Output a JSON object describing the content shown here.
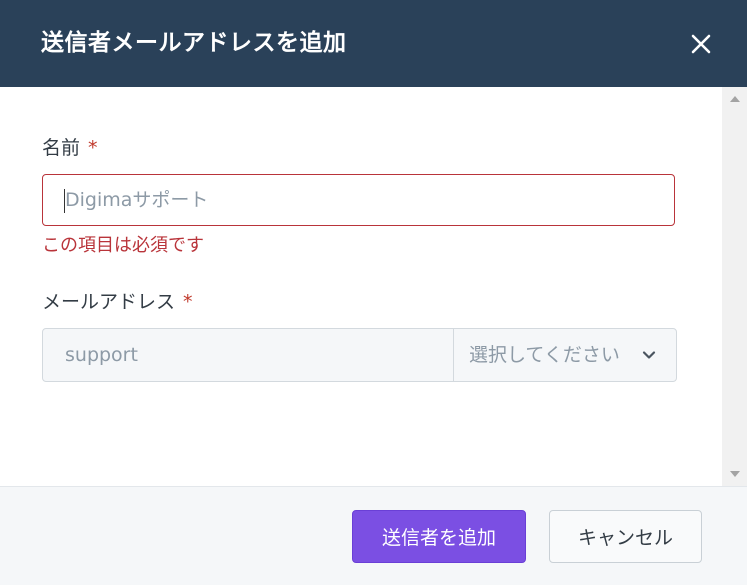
{
  "dialog": {
    "title": "送信者メールアドレスを追加",
    "close_icon": "close-icon"
  },
  "form": {
    "name": {
      "label": "名前",
      "required_mark": "*",
      "placeholder": "Digimaサポート",
      "value": "",
      "error": "この項目は必須です"
    },
    "email": {
      "label": "メールアドレス",
      "required_mark": "*",
      "local_placeholder": "support",
      "local_value": "",
      "domain_selected": "選択してください",
      "dropdown_icon": "chevron-down-icon"
    }
  },
  "footer": {
    "submit_label": "送信者を追加",
    "cancel_label": "キャンセル"
  },
  "colors": {
    "header_bg": "#2a4159",
    "error": "#b9343a",
    "primary": "#7b4fe3"
  }
}
